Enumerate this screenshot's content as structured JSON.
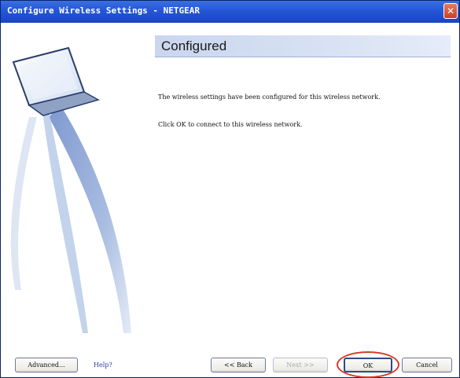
{
  "window": {
    "title": "Configure Wireless Settings - NETGEAR",
    "close_icon": "close-icon",
    "colors": {
      "titlebar": "#2457d6",
      "close_button": "#c7402a",
      "heading_bar": "#d8e2f3",
      "highlight": "#d33a2a"
    }
  },
  "page": {
    "heading": "Configured",
    "paragraphs": [
      "The wireless settings have been configured for this wireless network.",
      "Click OK to connect to this wireless network."
    ]
  },
  "footer": {
    "advanced_label": "Advanced...",
    "help_label": "Help?",
    "back_label": "<< Back",
    "next_label": "Next >>",
    "ok_label": "OK",
    "cancel_label": "Cancel"
  }
}
